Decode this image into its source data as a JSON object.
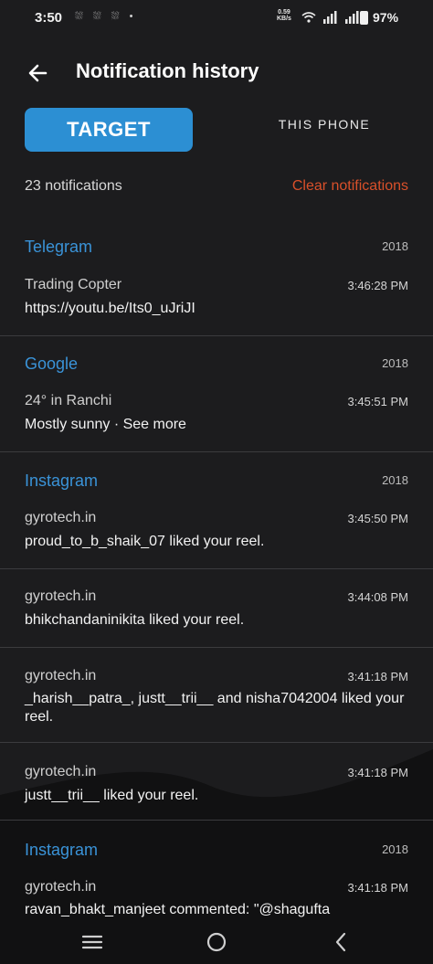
{
  "status_bar": {
    "time": "3:50",
    "notif_icons": "⛆ ⛆ ⛆ •",
    "speed_value": "0.59",
    "speed_unit": "KB/s",
    "battery": "97%"
  },
  "header": {
    "title": "Notification history"
  },
  "tabs": {
    "target": "TARGET",
    "this_phone": "THIS PHONE"
  },
  "summary": {
    "count": "23 notifications",
    "clear": "Clear notifications"
  },
  "colors": {
    "accent": "#2c8fd3",
    "app_name": "#3a93d8",
    "danger": "#d9502a",
    "background": "#1c1c1e"
  },
  "notifications": [
    {
      "app": "Telegram",
      "year": "2018",
      "title": "Trading Copter",
      "time": "3:46:28 PM",
      "body": "https://youtu.be/Its0_uJriJI"
    },
    {
      "app": "Google",
      "year": "2018",
      "title": "24° in Ranchi",
      "time": "3:45:51 PM",
      "body": "Mostly sunny · See more"
    },
    {
      "app": "Instagram",
      "year": "2018",
      "title": "gyrotech.in",
      "time": "3:45:50 PM",
      "body": "proud_to_b_shaik_07 liked your reel."
    },
    {
      "app": "",
      "year": "",
      "title": "gyrotech.in",
      "time": "3:44:08 PM",
      "body": "bhikchandaninikita liked your reel."
    },
    {
      "app": "",
      "year": "",
      "title": "gyrotech.in",
      "time": "3:41:18 PM",
      "body": "_harish__patra_, justt__trii__ and nisha7042004 liked your reel."
    },
    {
      "app": "",
      "year": "",
      "title": "gyrotech.in",
      "time": "3:41:18 PM",
      "body": "justt__trii__ liked your reel."
    },
    {
      "app": "Instagram",
      "year": "2018",
      "title": "gyrotech.in",
      "time": "3:41:18 PM",
      "body": "ravan_bhakt_manjeet commented: \"@shagufta"
    }
  ],
  "navbar": {
    "icons": [
      "menu-icon",
      "home-circle-icon",
      "back-chevron-icon"
    ]
  }
}
